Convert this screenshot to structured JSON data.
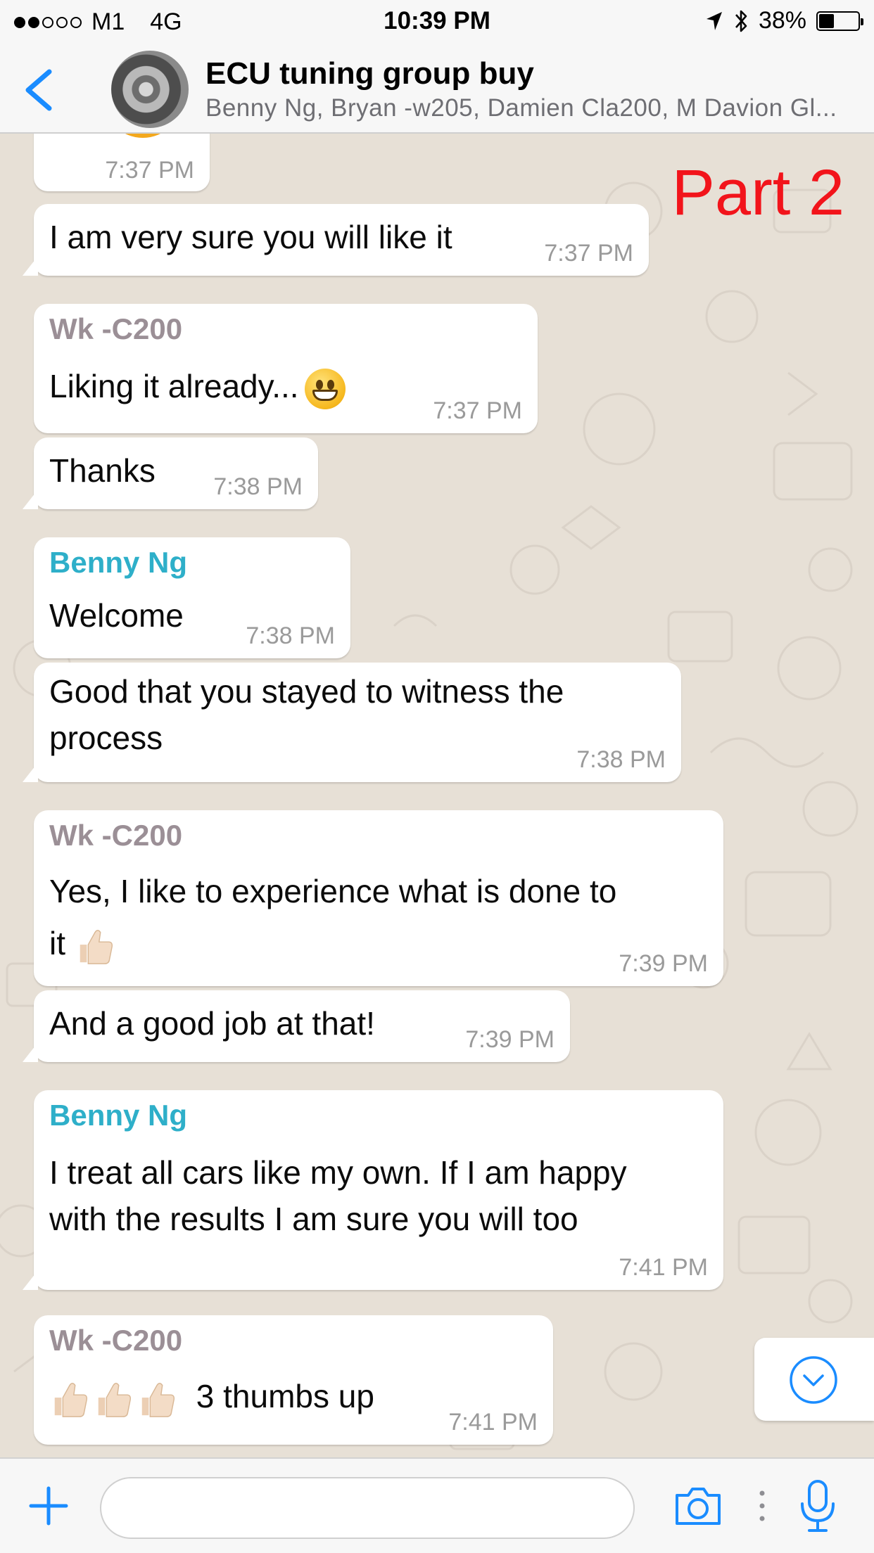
{
  "status_bar": {
    "carrier": "M1",
    "network": "4G",
    "time": "10:39 PM",
    "battery_percent": "38%",
    "battery_level": 0.38,
    "signal_dots_filled": 2,
    "signal_dots_total": 5
  },
  "header": {
    "title": "ECU tuning group buy",
    "members": "Benny Ng, Bryan -w205, Damien Cla200, M Davion Gl..."
  },
  "overlay": {
    "part_label": "Part 2"
  },
  "messages": [
    {
      "sender": "",
      "text": "",
      "time": "7:37 PM"
    },
    {
      "sender": "",
      "text": "I am very sure you will like it",
      "time": "7:37 PM"
    },
    {
      "sender": "Wk -C200",
      "text": "Liking it already...",
      "time": "7:37 PM",
      "emoji": "grinning-face"
    },
    {
      "sender": "",
      "text": "Thanks",
      "time": "7:38 PM"
    },
    {
      "sender": "Benny Ng",
      "text": "Welcome",
      "time": "7:38 PM"
    },
    {
      "sender": "",
      "text_line1": "Good that you stayed to witness the",
      "text_line2": "process",
      "time": "7:38 PM"
    },
    {
      "sender": "Wk -C200",
      "text_line1": "Yes, I like to experience what is done to",
      "text_line2": "it",
      "time": "7:39 PM",
      "emoji": "thumbs-up"
    },
    {
      "sender": "",
      "text": "And a good job at that!",
      "time": "7:39 PM"
    },
    {
      "sender": "Benny Ng",
      "text_line1": "I treat all cars like my own. If I am happy",
      "text_line2": "with the results I am sure you will too",
      "time": "7:41 PM"
    },
    {
      "sender": "Wk -C200",
      "text": "3 thumbs up",
      "time": "7:41 PM",
      "emoji": "thumbs-up x3"
    }
  ],
  "colors": {
    "accent_blue": "#1a8cff",
    "sender_gray": "#9b8f96",
    "sender_teal": "#2eafc9",
    "part_label_red": "#f2141b",
    "chat_background": "#e7e0d6"
  },
  "input": {
    "placeholder": ""
  },
  "icons": [
    "back-chevron-icon",
    "plus-icon",
    "camera-icon",
    "more-dots-icon",
    "microphone-icon",
    "scroll-down-chevron-icon",
    "location-arrow-icon",
    "bluetooth-icon",
    "battery-icon"
  ]
}
